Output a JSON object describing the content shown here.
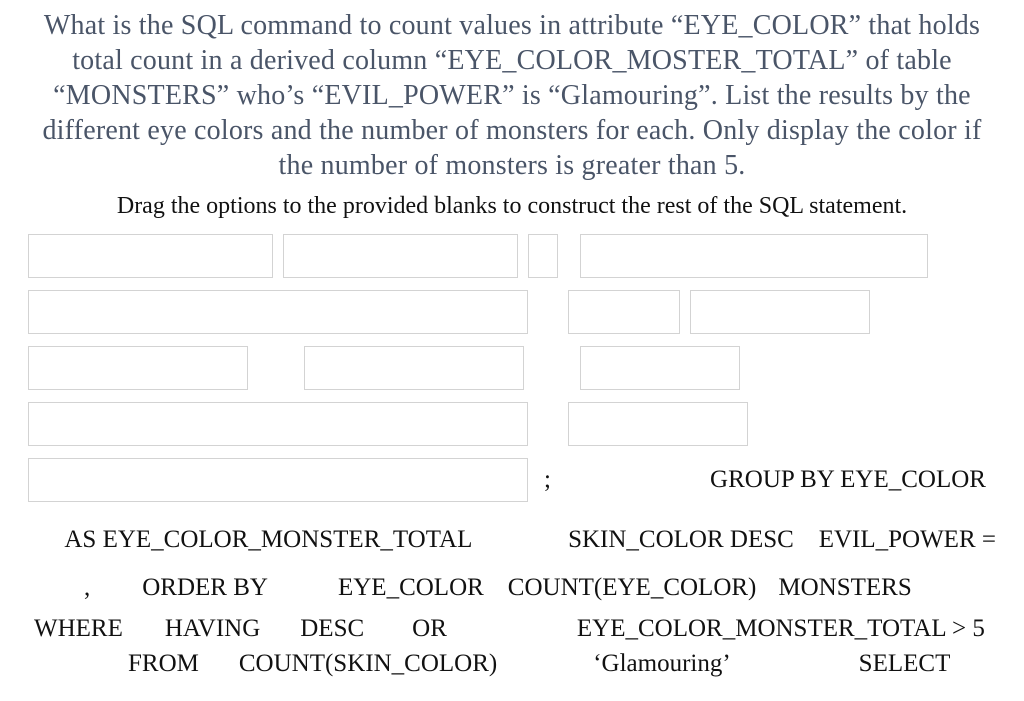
{
  "question": "What is the SQL command to count values in attribute “EYE_COLOR” that holds total count in a derived column “EYE_COLOR_MOSTER_TOTAL” of table “MONSTERS” who’s “EVIL_POWER” is “Glamouring”. List the results by the different eye colors and the number of monsters for each. Only display the color if the number of monsters is greater than 5.",
  "instruction": "Drag the options to the provided blanks to construct the rest of the SQL statement.",
  "semicolon": ";",
  "fixed_option": "GROUP BY EYE_COLOR",
  "options": {
    "as_alias": "AS EYE_COLOR_MONSTER_TOTAL",
    "skin_color_desc": "SKIN_COLOR DESC",
    "evil_power_eq": "EVIL_POWER =",
    "comma": ",",
    "order_by": "ORDER BY",
    "eye_color": "EYE_COLOR",
    "count_eye_color": "COUNT(EYE_COLOR)",
    "monsters": "MONSTERS",
    "where": "WHERE",
    "having": "HAVING",
    "desc": "DESC",
    "or": "OR",
    "gt5": "EYE_COLOR_MONSTER_TOTAL > 5",
    "from": "FROM",
    "count_skin_color": "COUNT(SKIN_COLOR)",
    "glamouring": "‘Glamouring’",
    "select": "SELECT"
  }
}
